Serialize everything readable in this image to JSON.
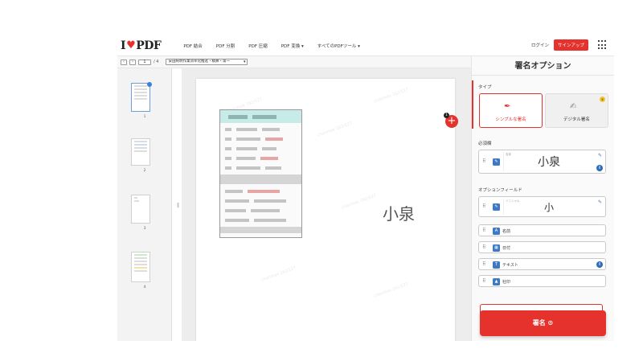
{
  "nav": {
    "logo_left": "I",
    "logo_right": "PDF",
    "items": [
      "PDF 結合",
      "PDF 分割",
      "PDF 圧縮",
      "PDF 変換 ▾",
      "すべてのPDFツール ▾"
    ],
    "login": "ログイン",
    "signup": "サインアップ"
  },
  "toolbar": {
    "page_value": "1",
    "page_total": "/ 4",
    "document": "安田純明作業効率化推進・積算・第一"
  },
  "thumbnails": [
    "1",
    "2",
    "3",
    "4"
  ],
  "canvas": {
    "signature_text": "小泉",
    "add_badge": "1",
    "watermark": "chanmax 162/127"
  },
  "panel": {
    "title": "署名オプション",
    "type_label": "タイプ",
    "types": [
      "シンプルな署名",
      "デジタル署名"
    ],
    "required_label": "必須欄",
    "required_field": {
      "tag": "名前",
      "value": "小泉"
    },
    "optional_label": "オプションフィールド",
    "optional_signature": {
      "tag": "イニシャル",
      "value": "小"
    },
    "optional_fields": [
      "名前",
      "日付",
      "テキスト",
      "社印"
    ],
    "sign_button": "署名 ⊙"
  },
  "colors": {
    "accent": "#e5322d",
    "field_icon": "#3f78c4"
  }
}
